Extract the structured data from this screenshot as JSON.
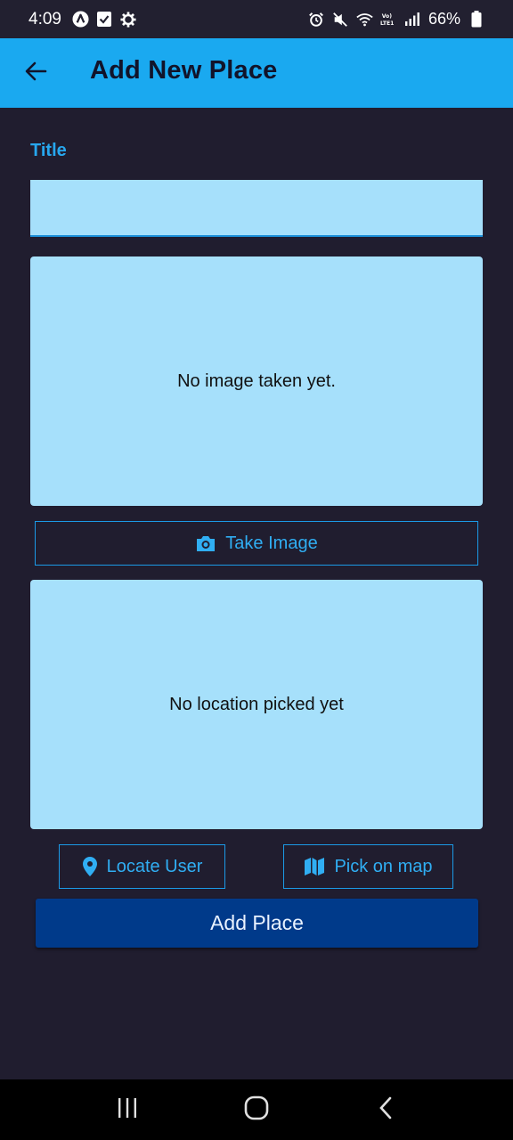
{
  "status_bar": {
    "time": "4:09",
    "battery": "66%",
    "left_icons": [
      "app-notification-icon",
      "checkbox-notification-icon",
      "settings-gear-icon"
    ],
    "right_icons": [
      "alarm-icon",
      "mute-icon",
      "wifi-icon",
      "volte-icon",
      "signal-icon",
      "battery-icon"
    ]
  },
  "app_bar": {
    "title": "Add New Place",
    "back_icon": "arrow-left-icon",
    "color": "#1aa9f0"
  },
  "form": {
    "title_label": "Title",
    "title_value": "",
    "title_placeholder": ""
  },
  "image_preview": {
    "text": "No image taken yet."
  },
  "take_image_button": {
    "label": "Take Image",
    "icon": "camera-icon"
  },
  "location_preview": {
    "text": "No location picked yet"
  },
  "locate_user_button": {
    "label": "Locate User",
    "icon": "location-pin-icon"
  },
  "pick_on_map_button": {
    "label": "Pick on map",
    "icon": "map-icon"
  },
  "add_place_button": {
    "label": "Add Place",
    "color": "#003a8a"
  },
  "nav_bar": {
    "buttons": [
      "recent-apps-icon",
      "home-icon",
      "back-icon"
    ]
  },
  "colors": {
    "background": "#201d2f",
    "accent": "#1aa9f0",
    "preview_fill": "#a6e0fb"
  }
}
